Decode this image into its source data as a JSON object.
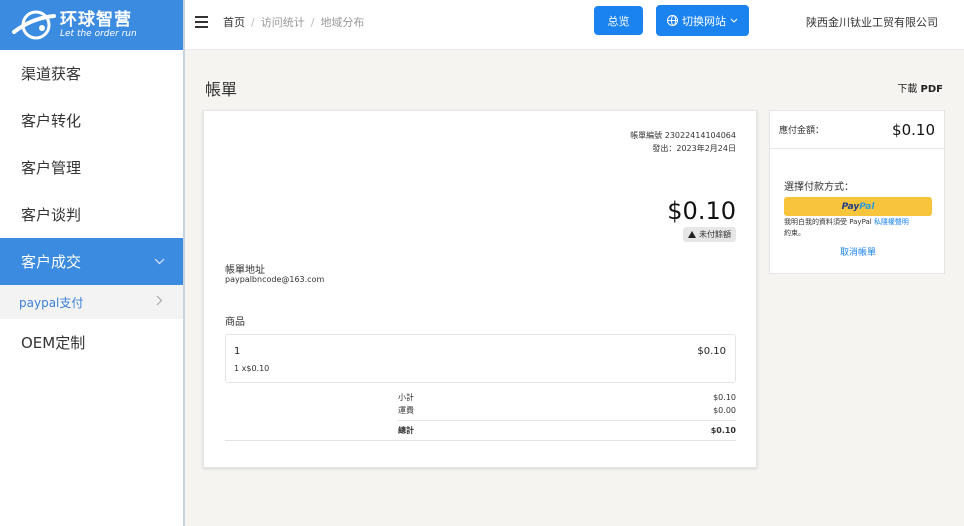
{
  "logo": {
    "title": "环球智营",
    "subtitle": "Let the order run"
  },
  "sidebar": {
    "items": [
      {
        "label": "渠道获客"
      },
      {
        "label": "客户转化"
      },
      {
        "label": "客户管理"
      },
      {
        "label": "客户谈判"
      },
      {
        "label": "客户成交"
      },
      {
        "label": "OEM定制"
      }
    ],
    "sub_item": {
      "label": "paypal支付"
    }
  },
  "header": {
    "breadcrumbs": [
      "首页",
      "访问统计",
      "地域分布"
    ],
    "overview_label": "总览",
    "switch_label": "切换网站",
    "company": "陕西金川钛业工贸有限公司"
  },
  "main": {
    "title": "帳單",
    "download_prefix": "下載",
    "download_format": "PDF"
  },
  "invoice": {
    "number": "帳單編號 23022414104064",
    "issued": "發出：2023年2月24日",
    "amount": "$0.10",
    "status": "未付餘額",
    "address_label": "帳單地址",
    "email": "paypalbncode@163.com",
    "goods_label": "商品",
    "item": {
      "name": "1",
      "price": "$0.10",
      "qty": "1 x$0.10"
    },
    "subtotal_label": "小計",
    "subtotal": "$0.10",
    "shipping_label": "運費",
    "shipping": "$0.00",
    "total_label": "總計",
    "total": "$0.10"
  },
  "payment": {
    "due_label": "應付金額：",
    "due_amount": "$0.10",
    "method_label": "選擇付款方式：",
    "paypal_part1": "Pay",
    "paypal_part2": "Pal",
    "terms_text": "我明白我的資料須受 PayPal ",
    "terms_link": "私隱權聲明",
    "terms_tail": "約束。",
    "cancel_label": "取消帳單"
  },
  "colors": {
    "primary": "#3b8be0",
    "button": "#1a83f0",
    "paypal": "#f7c43b"
  }
}
